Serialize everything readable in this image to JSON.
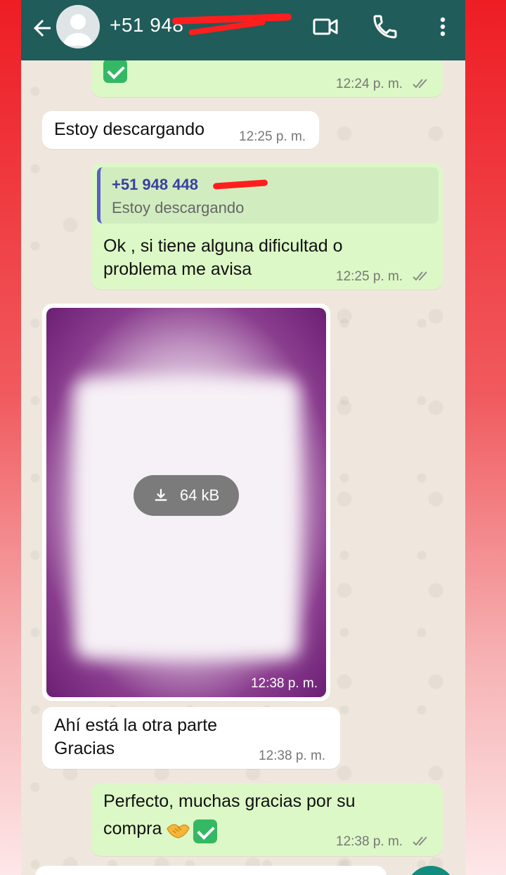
{
  "header": {
    "contact": "+51 948",
    "icons": [
      "back-arrow-icon",
      "video-call-icon",
      "voice-call-icon",
      "more-options-icon"
    ]
  },
  "messages": [
    {
      "direction": "out",
      "time": "12:24 p. m."
    },
    {
      "direction": "in",
      "text": "Estoy descargando",
      "time": "12:25 p. m."
    },
    {
      "direction": "out",
      "quote_name": "+51 948 448",
      "quote_text": "Estoy descargando",
      "line1": "Ok , si tiene alguna dificultad o",
      "line2": "problema me avisa",
      "time": "12:25 p. m."
    },
    {
      "direction": "in",
      "type": "image",
      "download_size": "64 kB",
      "time": "12:38 p. m."
    },
    {
      "direction": "in",
      "line1": "Ahí está la otra parte",
      "line2": "Gracias",
      "time": "12:38 p. m."
    },
    {
      "direction": "out",
      "line1": "Perfecto, muchas gracias por su",
      "line2": "compra",
      "time": "12:38 p. m."
    }
  ],
  "colors": {
    "header": "#1f5c5a",
    "outgoing_bubble": "#dcf8c6",
    "incoming_bubble": "#ffffff",
    "chat_background": "#efe7dd",
    "accent_red": "#ff1e1e"
  }
}
